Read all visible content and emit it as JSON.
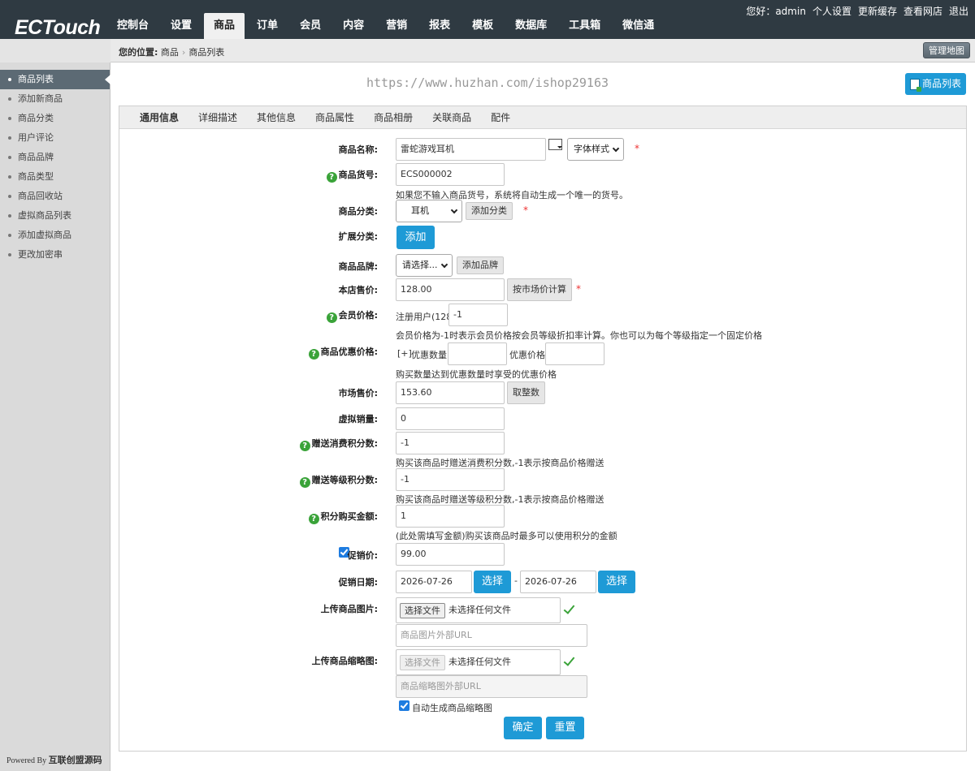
{
  "brand": {
    "logo": "ECTouch"
  },
  "nav": {
    "items": [
      {
        "label": "控制台"
      },
      {
        "label": "设置"
      },
      {
        "label": "商品"
      },
      {
        "label": "订单"
      },
      {
        "label": "会员"
      },
      {
        "label": "内容"
      },
      {
        "label": "营销"
      },
      {
        "label": "报表"
      },
      {
        "label": "模板"
      },
      {
        "label": "数据库"
      },
      {
        "label": "工具箱"
      },
      {
        "label": "微信通"
      }
    ],
    "active_index": 2
  },
  "top_links": {
    "greeting": "您好：admin",
    "personal": "个人设置",
    "refresh": "更新缓存",
    "view_site": "查看网店",
    "logout": "退出"
  },
  "breadcrumb": {
    "prefix": "您的位置:",
    "level1": "商品",
    "level2": "商品列表"
  },
  "sitemap_button": "管理地图",
  "sidebar": {
    "items": [
      {
        "label": "商品列表"
      },
      {
        "label": "添加新商品"
      },
      {
        "label": "商品分类"
      },
      {
        "label": "用户评论"
      },
      {
        "label": "商品品牌"
      },
      {
        "label": "商品类型"
      },
      {
        "label": "商品回收站"
      },
      {
        "label": "虚拟商品列表"
      },
      {
        "label": "添加虚拟商品"
      },
      {
        "label": "更改加密串"
      }
    ],
    "active_index": 0,
    "powered_prefix": "Powered By",
    "powered_brand": "互联创盟源码"
  },
  "watermark": "https://www.huzhan.com/ishop29163",
  "goods_list_button": "商品列表",
  "tabs": [
    "通用信息",
    "详细描述",
    "其他信息",
    "商品属性",
    "商品相册",
    "关联商品",
    "配件"
  ],
  "form": {
    "name": {
      "label": "商品名称:",
      "value": "雷蛇游戏耳机",
      "font_style": "字体样式"
    },
    "sn": {
      "label": "商品货号:",
      "value": "ECS000002",
      "hint": "如果您不输入商品货号，系统将自动生成一个唯一的货号。"
    },
    "category": {
      "label": "商品分类:",
      "value": "耳机",
      "add": "添加分类"
    },
    "ext_category": {
      "label": "扩展分类:",
      "add": "添加"
    },
    "brand": {
      "label": "商品品牌:",
      "value": "请选择...",
      "add": "添加品牌"
    },
    "shop_price": {
      "label": "本店售价:",
      "value": "128.00",
      "calc": "按市场价计算"
    },
    "member_price": {
      "label": "会员价格:",
      "user_label": "注册用户(128)",
      "value": "-1",
      "hint": "会员价格为-1时表示会员价格按会员等级折扣率计算。你也可以为每个等级指定一个固定价格"
    },
    "volume_price": {
      "label": "商品优惠价格:",
      "add": "[+]",
      "qty_label": "优惠数量",
      "price_label": "优惠价格",
      "hint": "购买数量达到优惠数量时享受的优惠价格"
    },
    "market_price": {
      "label": "市场售价:",
      "value": "153.60",
      "round": "取整数"
    },
    "virtual_sales": {
      "label": "虚拟销量:",
      "value": "0"
    },
    "give_integral": {
      "label": "赠送消费积分数:",
      "value": "-1",
      "hint": "购买该商品时赠送消费积分数,-1表示按商品价格赠送"
    },
    "rank_integral": {
      "label": "赠送等级积分数:",
      "value": "-1",
      "hint": "购买该商品时赠送等级积分数,-1表示按商品价格赠送"
    },
    "integral": {
      "label": "积分购买金额:",
      "value": "1",
      "hint": "(此处需填写金额)购买该商品时最多可以使用积分的金额"
    },
    "promote_price": {
      "label": "促销价:",
      "value": "99.00"
    },
    "promote_date": {
      "label": "促销日期:",
      "start": "2026-07-26",
      "end": "2026-07-26",
      "pick": "选择",
      "sep": "-"
    },
    "goods_img": {
      "label": "上传商品图片:",
      "choose": "选择文件",
      "none": "未选择任何文件",
      "url_placeholder": "商品图片外部URL"
    },
    "goods_thumb": {
      "label": "上传商品缩略图:",
      "choose": "选择文件",
      "none": "未选择任何文件",
      "url_placeholder": "商品缩略图外部URL",
      "auto": "自动生成商品缩略图"
    },
    "submit": "确定",
    "reset": "重置"
  },
  "colors": {
    "topbar": "#2f3a42",
    "accent": "#1e9ad6",
    "help": "#3aa339",
    "required": "#e33333"
  }
}
